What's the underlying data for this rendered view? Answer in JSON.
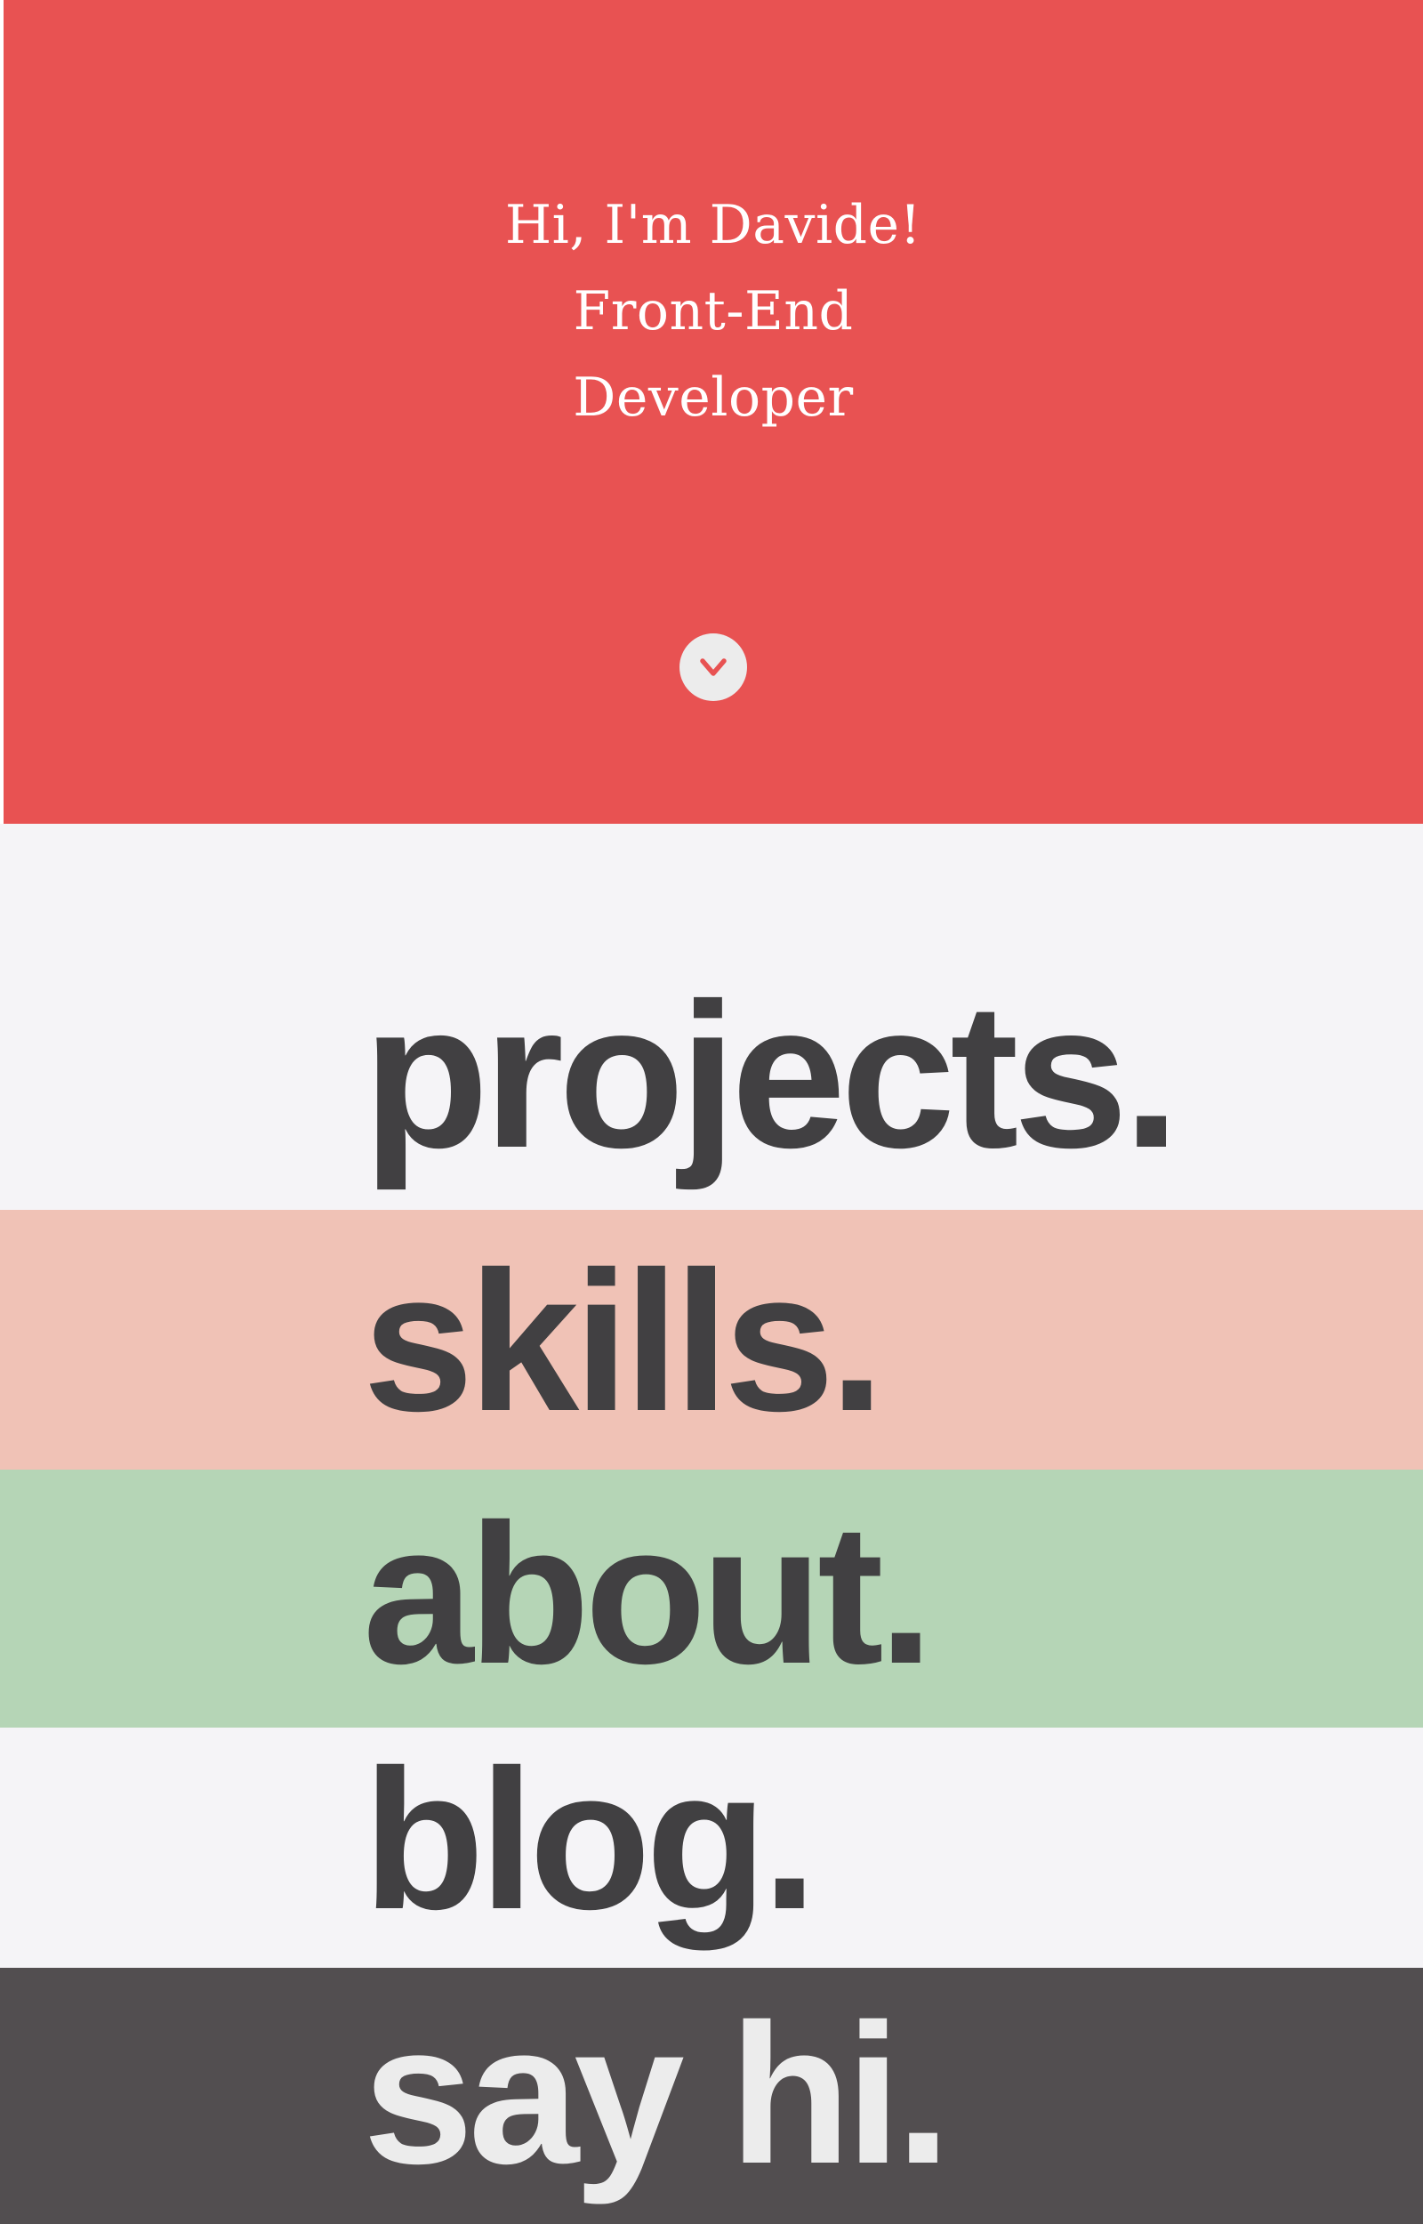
{
  "hero": {
    "lines": [
      "Hi, I'm Davide!",
      "Front-End",
      "Developer"
    ],
    "scroll_icon": "chevron-down-icon",
    "background_color": "#e85252",
    "icon_color": "#e85252"
  },
  "sections": [
    {
      "label": "projects.",
      "background_color": "#f5f4f7",
      "text_color": "#414042"
    },
    {
      "label": "skills.",
      "background_color": "#f0c2b6",
      "text_color": "#414042"
    },
    {
      "label": "about.",
      "background_color": "#b5d5b6",
      "text_color": "#414042"
    },
    {
      "label": "blog.",
      "background_color": "#f5f4f7",
      "text_color": "#414042"
    },
    {
      "label": "say hi.",
      "background_color": "#524e50",
      "text_color": "#ececec"
    }
  ]
}
